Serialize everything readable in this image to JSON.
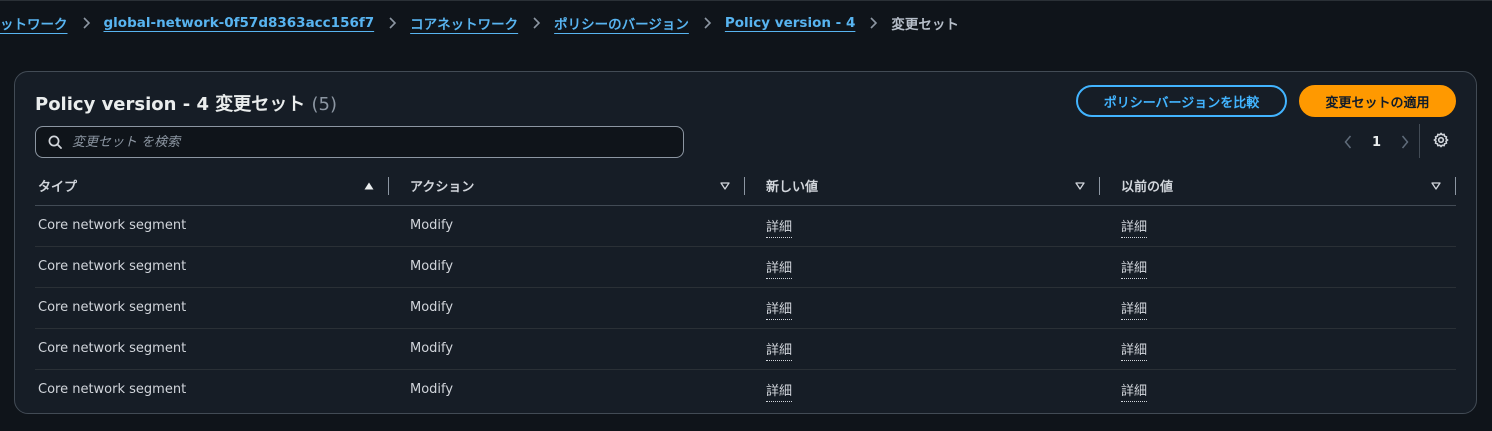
{
  "breadcrumb": {
    "items": [
      {
        "label": "ットワーク",
        "link": true
      },
      {
        "label": "global-network-0f57d8363acc156f7",
        "link": true
      },
      {
        "label": "コアネットワーク",
        "link": true
      },
      {
        "label": "ポリシーのバージョン",
        "link": true
      },
      {
        "label": "Policy version - 4",
        "link": true
      },
      {
        "label": "変更セット",
        "link": false
      }
    ]
  },
  "panel": {
    "title": "Policy version - 4 変更セット",
    "count": "(5)",
    "compare_button": "ポリシーバージョンを比較",
    "apply_button": "変更セットの適用"
  },
  "search": {
    "placeholder": "変更セット を検索",
    "value": ""
  },
  "pagination": {
    "current_page": "1"
  },
  "table": {
    "columns": [
      {
        "label": "タイプ",
        "sort": "asc"
      },
      {
        "label": "アクション",
        "sort": "none"
      },
      {
        "label": "新しい値",
        "sort": "none"
      },
      {
        "label": "以前の値",
        "sort": "none"
      }
    ],
    "rows": [
      {
        "type": "Core network segment",
        "action": "Modify",
        "new_value": "詳細",
        "previous_value": "詳細"
      },
      {
        "type": "Core network segment",
        "action": "Modify",
        "new_value": "詳細",
        "previous_value": "詳細"
      },
      {
        "type": "Core network segment",
        "action": "Modify",
        "new_value": "詳細",
        "previous_value": "詳細"
      },
      {
        "type": "Core network segment",
        "action": "Modify",
        "new_value": "詳細",
        "previous_value": "詳細"
      },
      {
        "type": "Core network segment",
        "action": "Modify",
        "new_value": "詳細",
        "previous_value": "詳細"
      }
    ]
  },
  "icons": {
    "breadcrumb_separator": "chevron-right-icon",
    "search": "search-icon",
    "prev_page": "chevron-left-icon",
    "next_page": "chevron-right-icon",
    "settings": "gear-icon",
    "sort_asc": "caret-up-icon",
    "sort_none": "caret-down-icon"
  },
  "colors": {
    "background": "#0f141a",
    "panel": "#161d26",
    "link": "#58b4f0",
    "primary_button": "#ff9900",
    "secondary_border": "#42b4ff"
  }
}
